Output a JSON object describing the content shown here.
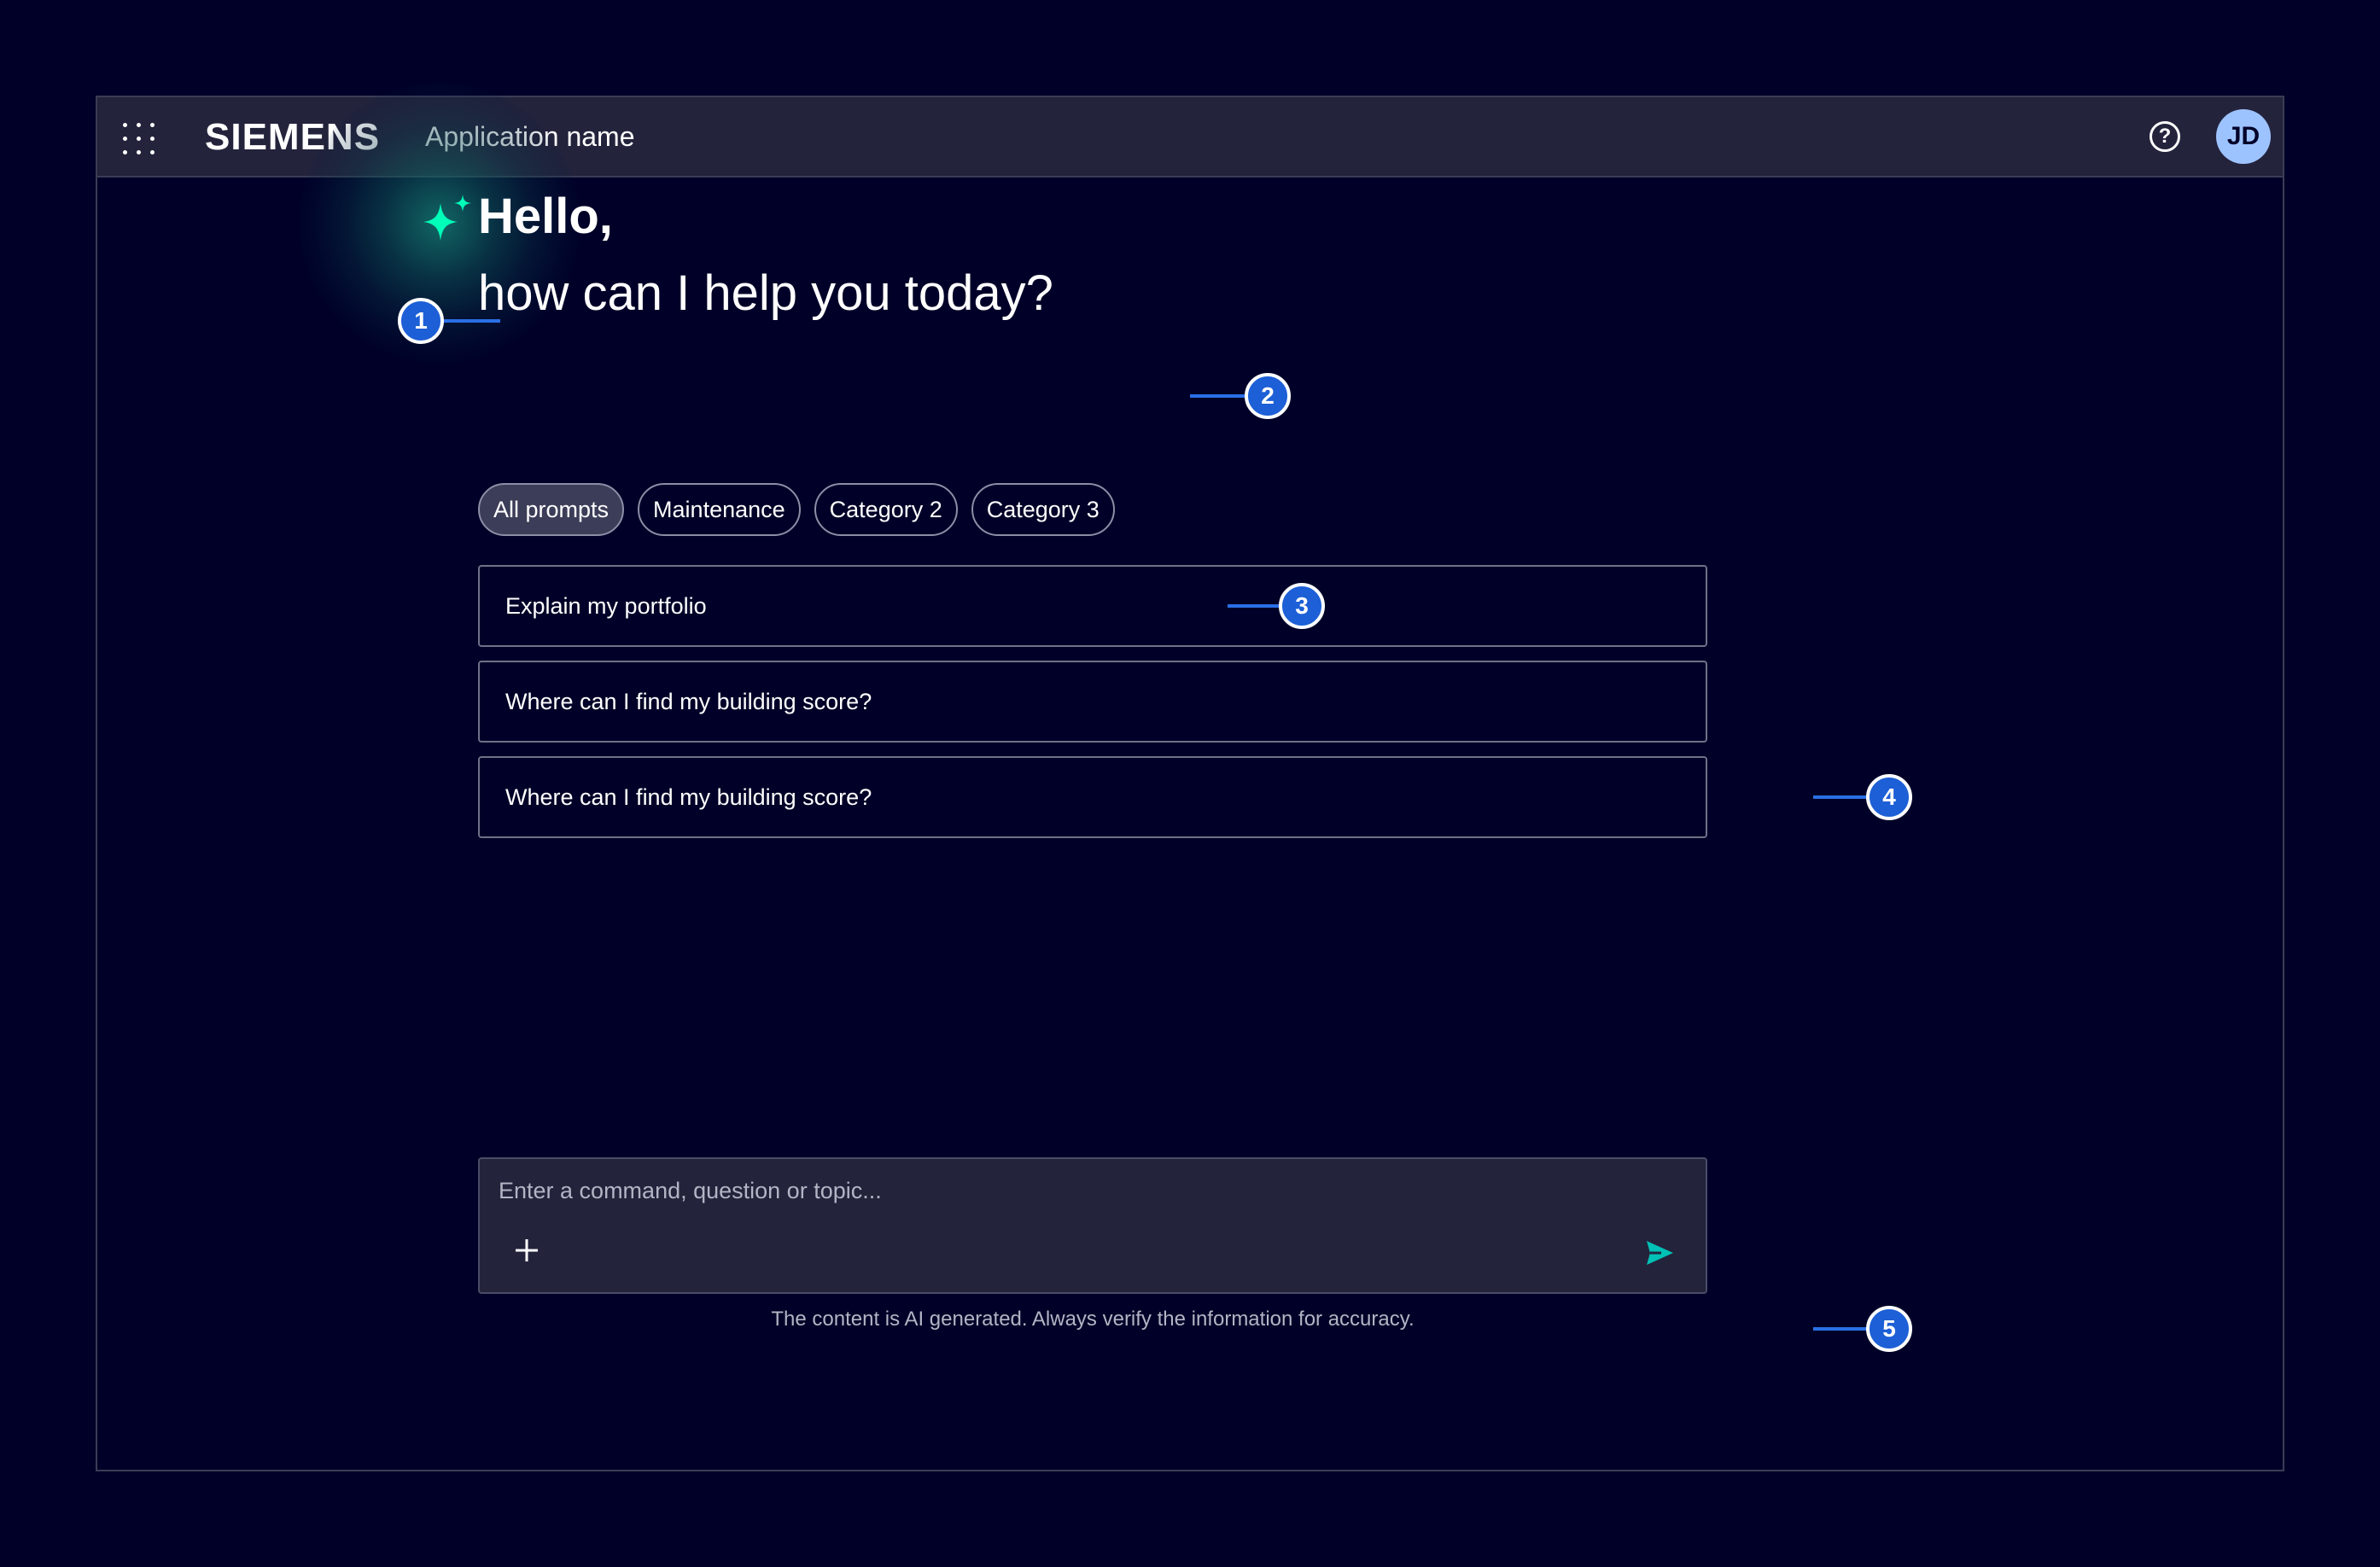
{
  "header": {
    "brand": "SIEMENS",
    "app_name": "Application name",
    "avatar_initials": "JD"
  },
  "greeting": {
    "line1": "Hello,",
    "line2": "how can I help you today?"
  },
  "categories": [
    {
      "label": "All prompts",
      "selected": true
    },
    {
      "label": "Maintenance",
      "selected": false
    },
    {
      "label": "Category 2",
      "selected": false
    },
    {
      "label": "Category 3",
      "selected": false
    }
  ],
  "prompts": [
    "Explain my portfolio",
    "Where can I find my building score?",
    "Where can I find my building score?"
  ],
  "composer": {
    "placeholder": "Enter a command, question or topic...",
    "disclaimer": "The content is AI generated. Always verify the information for accuracy."
  },
  "annotations": [
    "1",
    "2",
    "3",
    "4",
    "5"
  ],
  "colors": {
    "background": "#000028",
    "header": "#23233c",
    "accent": "#00ffb9",
    "send": "#00c1b6",
    "marker": "#1d5fd6",
    "avatar": "#9dc3ff"
  }
}
